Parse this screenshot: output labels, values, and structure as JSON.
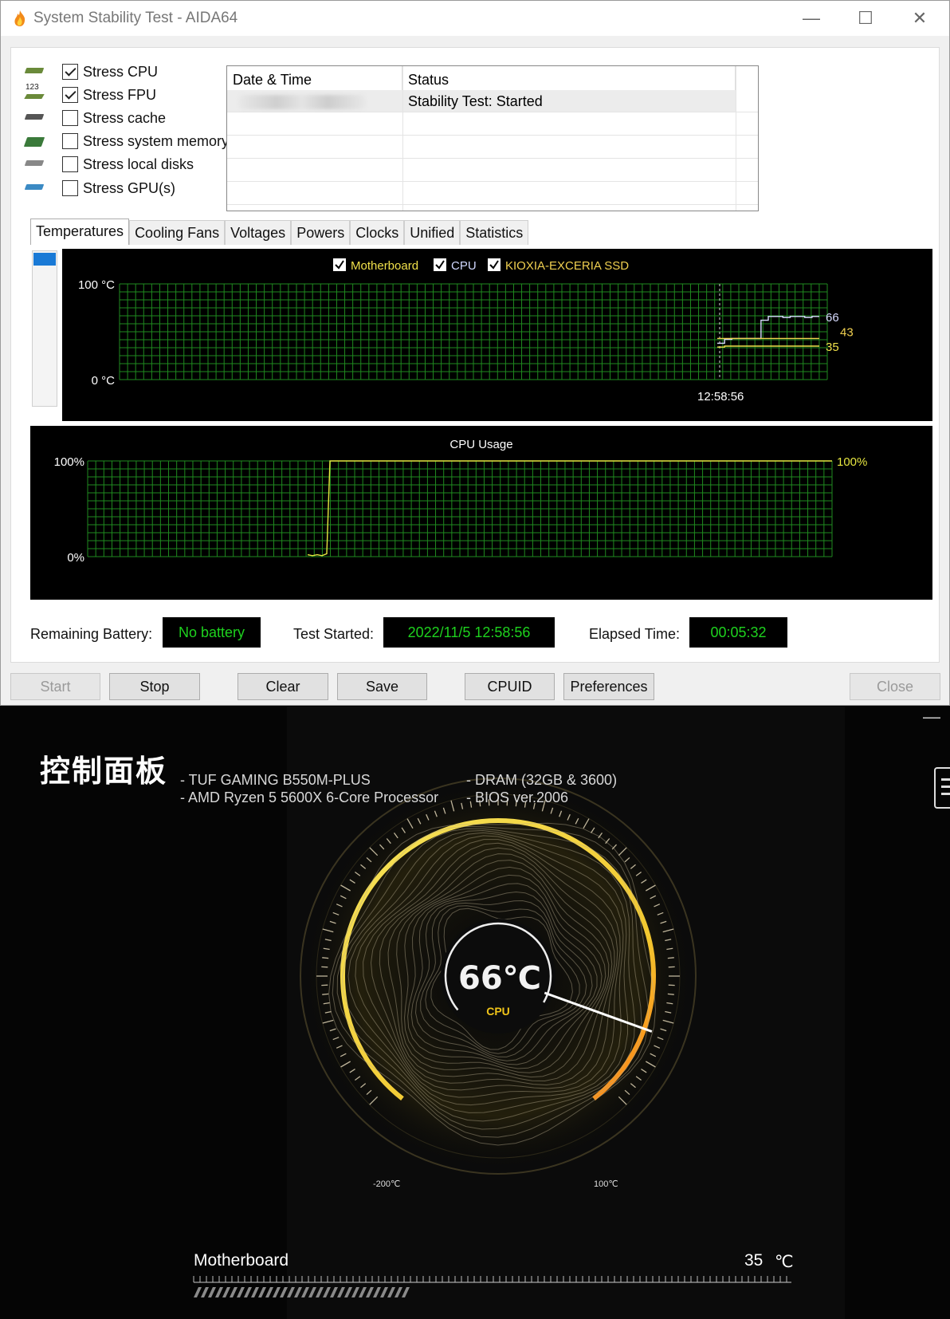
{
  "window": {
    "title": "System Stability Test - AIDA64",
    "min_glyph": "—",
    "max_glyph": "☐",
    "close_glyph": "✕"
  },
  "stress_options": [
    {
      "label": "Stress CPU",
      "checked": true,
      "icon": "cpu-chip-icon"
    },
    {
      "label": "Stress FPU",
      "checked": true,
      "icon": "fpu-123-icon"
    },
    {
      "label": "Stress cache",
      "checked": false,
      "icon": "cache-chip-icon"
    },
    {
      "label": "Stress system memory",
      "checked": false,
      "icon": "memory-module-icon"
    },
    {
      "label": "Stress local disks",
      "checked": false,
      "icon": "disk-drive-icon"
    },
    {
      "label": "Stress GPU(s)",
      "checked": false,
      "icon": "gpu-card-icon"
    }
  ],
  "log": {
    "headers": [
      "Date & Time",
      "Status"
    ],
    "rows": [
      {
        "status": "Stability Test: Started"
      }
    ]
  },
  "tabs": [
    "Temperatures",
    "Cooling Fans",
    "Voltages",
    "Powers",
    "Clocks",
    "Unified",
    "Statistics"
  ],
  "active_tab": "Temperatures",
  "legend": [
    {
      "name": "Motherboard",
      "color": "#f0e04a",
      "checked": true
    },
    {
      "name": "CPU",
      "color": "#d0d8ff",
      "checked": true
    },
    {
      "name": "KIOXIA-EXCERIA SSD",
      "color": "#f0d050",
      "checked": true
    }
  ],
  "chart_data": [
    {
      "type": "line",
      "title": "",
      "ylabel": "°C",
      "ylim": [
        0,
        100
      ],
      "y_tick_labels": [
        "100 °C",
        "0 °C"
      ],
      "x_marker_label": "12:58:56",
      "series": [
        {
          "name": "CPU",
          "color": "#d8dcff",
          "end_value": 66,
          "values": [
            38,
            42,
            43,
            43,
            43,
            43,
            62,
            66,
            66,
            65,
            66,
            66,
            65,
            66,
            66
          ]
        },
        {
          "name": "KIOXIA-EXCERIA SSD",
          "color": "#f0d050",
          "end_value": 43,
          "values": [
            43,
            43,
            43,
            43,
            43,
            43,
            43,
            43,
            43,
            43,
            43,
            43,
            43,
            43,
            43
          ]
        },
        {
          "name": "Motherboard",
          "color": "#f0e04a",
          "end_value": 35,
          "values": [
            34,
            35,
            35,
            35,
            35,
            35,
            35,
            35,
            35,
            35,
            35,
            35,
            35,
            35,
            35
          ]
        }
      ]
    },
    {
      "type": "line",
      "title": "CPU Usage",
      "ylim": [
        0,
        100
      ],
      "y_tick_labels": [
        "100%",
        "0%"
      ],
      "end_label": "100%",
      "series": [
        {
          "name": "CPU Usage",
          "color": "#e6e640",
          "values": [
            2,
            1,
            2,
            1,
            3,
            100,
            100,
            100,
            100,
            100,
            100,
            100,
            100,
            100,
            100,
            100,
            100,
            100,
            100,
            100,
            100,
            100,
            100,
            100,
            100,
            100,
            100,
            100,
            100,
            100,
            100,
            100,
            100,
            100,
            100,
            100,
            100,
            100,
            100,
            100,
            100
          ]
        }
      ]
    }
  ],
  "status": {
    "battery_label": "Remaining Battery:",
    "battery_value": "No battery",
    "started_label": "Test Started:",
    "started_value": "2022/11/5 12:58:56",
    "elapsed_label": "Elapsed Time:",
    "elapsed_value": "00:05:32"
  },
  "buttons": {
    "start": "Start",
    "stop": "Stop",
    "clear": "Clear",
    "save": "Save",
    "cpuid": "CPUID",
    "preferences": "Preferences",
    "close": "Close"
  },
  "armoury": {
    "title": "控制面板",
    "specs": [
      "-   TUF GAMING B550M-PLUS",
      "-   AMD Ryzen 5 5600X 6-Core Processor",
      "-   DRAM (32GB & 3600)",
      "-   BIOS ver.2006"
    ],
    "minimize_glyph": "—",
    "gauge": {
      "value": "66℃",
      "label": "CPU",
      "min_label": "-200℃",
      "max_label": "100℃",
      "min": -200,
      "max": 100,
      "reading": 66
    },
    "motherboard": {
      "label": "Motherboard",
      "value": "35",
      "unit": "℃"
    },
    "accent_color": "#f0c419"
  }
}
